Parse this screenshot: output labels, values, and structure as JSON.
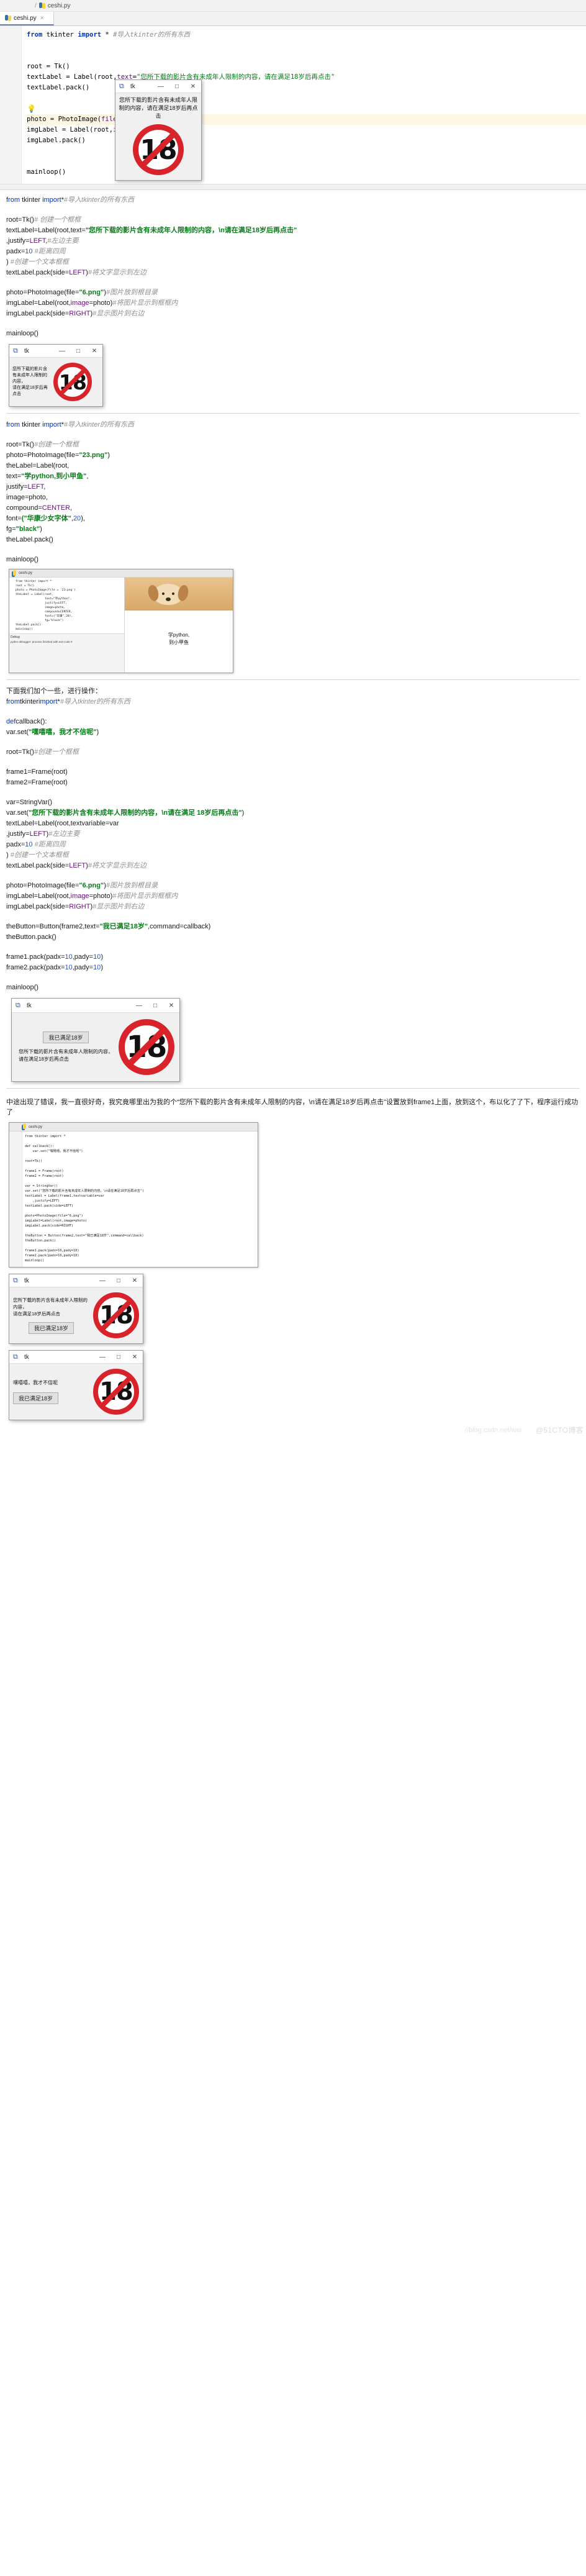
{
  "ide": {
    "breadcrumb": "ceshi.py",
    "tab_label": "ceshi.py",
    "close_glyph": "×",
    "python_icon": "python-file-icon"
  },
  "code_block_1": {
    "lines": [
      {
        "segs": [
          {
            "t": "from ",
            "c": "kw"
          },
          {
            "t": "tkinter ",
            "c": "t"
          },
          {
            "t": "import ",
            "c": "kw"
          },
          {
            "t": "* ",
            "c": "t"
          },
          {
            "t": "#导入tkinter的所有东西",
            "c": "c"
          }
        ]
      },
      {
        "segs": []
      },
      {
        "segs": []
      },
      {
        "segs": [
          {
            "t": "root = Tk()",
            "c": "t"
          }
        ]
      },
      {
        "segs": [
          {
            "t": "textLabel = Label(root,",
            "c": "t"
          },
          {
            "t": "text",
            "c": "p"
          },
          {
            "t": "=",
            "c": "t"
          },
          {
            "t": "\"您所下载的影片含有未成年人限制的内容，请在满足18岁后再点击\"",
            "c": "s"
          }
        ]
      },
      {
        "segs": [
          {
            "t": "textLabel.pack()",
            "c": "t"
          }
        ]
      },
      {
        "segs": []
      },
      {
        "segs": [
          {
            "t": "💡",
            "c": "t"
          }
        ],
        "bulb": true
      },
      {
        "segs": [
          {
            "t": "photo = PhotoImage(",
            "c": "t"
          },
          {
            "t": "file",
            "c": "p"
          },
          {
            "t": "=",
            "c": "t"
          },
          {
            "t": "\"6.png\"",
            "c": "s"
          },
          {
            "t": ")",
            "c": "t"
          }
        ],
        "hl": true
      },
      {
        "segs": [
          {
            "t": "imgLabel = Label(root,",
            "c": "t"
          },
          {
            "t": "image",
            "c": "p"
          },
          {
            "t": "=",
            "c": "t"
          },
          {
            "t": "photo)",
            "c": "t"
          }
        ]
      },
      {
        "segs": [
          {
            "t": "imgLabel.pack()",
            "c": "t"
          }
        ]
      },
      {
        "segs": []
      },
      {
        "segs": []
      },
      {
        "segs": [
          {
            "t": "mainloop()",
            "c": "t"
          }
        ]
      }
    ]
  },
  "tk_window_1": {
    "title": "tk",
    "message": "您所下载的影片含有未成年人限制的内容，请在满足18岁后再点击",
    "minimize": "—",
    "maximize": "□",
    "close": "✕",
    "sign_number": "18"
  },
  "text_block_1": {
    "lines": [
      [
        {
          "t": "from ",
          "c": "kwb"
        },
        {
          "t": "tkinter ",
          "c": ""
        },
        {
          "t": "import",
          "c": "kwb"
        },
        {
          "t": "*",
          "c": ""
        },
        {
          "t": "#导入tkinter的所有东西",
          "c": "cm"
        }
      ],
      [],
      [
        {
          "t": "root=Tk()",
          "c": ""
        },
        {
          "t": "# 创建一个框框",
          "c": "cm"
        }
      ],
      [
        {
          "t": "textLabel=Label(root,text=",
          "c": ""
        },
        {
          "t": "\"您所下载的影片含有未成年人限制的内容，\\n请在满足18岁后再点击\"",
          "c": "stb"
        }
      ],
      [
        {
          "t": ",justify=",
          "c": ""
        },
        {
          "t": "LEFT",
          "c": "pb"
        },
        {
          "t": ",",
          "c": ""
        },
        {
          "t": "#左边主要",
          "c": "cm"
        }
      ],
      [
        {
          "t": "padx=",
          "c": ""
        },
        {
          "t": "10",
          "c": "nb"
        },
        {
          "t": "    ",
          "c": ""
        },
        {
          "t": "#距离四周",
          "c": "cm"
        }
      ],
      [
        {
          "t": ")",
          "c": ""
        },
        {
          "t": "    #创建一个文本框框",
          "c": "cm"
        }
      ],
      [
        {
          "t": "textLabel.pack(side=",
          "c": ""
        },
        {
          "t": "LEFT",
          "c": "pb"
        },
        {
          "t": ")",
          "c": ""
        },
        {
          "t": "#将文字显示到左边",
          "c": "cm"
        }
      ],
      [],
      [
        {
          "t": "photo=PhotoImage(file=",
          "c": ""
        },
        {
          "t": "\"6.png\"",
          "c": "stb"
        },
        {
          "t": ")",
          "c": ""
        },
        {
          "t": "#图片放到根目录",
          "c": "cm"
        }
      ],
      [
        {
          "t": "imgLabel=Label(root,",
          "c": ""
        },
        {
          "t": "image",
          "c": "pb"
        },
        {
          "t": "=photo)",
          "c": ""
        },
        {
          "t": "#将图片显示到框框内",
          "c": "cm"
        }
      ],
      [
        {
          "t": "imgLabel.pack(side=",
          "c": ""
        },
        {
          "t": "RIGHT",
          "c": "pb"
        },
        {
          "t": ")",
          "c": ""
        },
        {
          "t": "#显示图片到右边",
          "c": "cm"
        }
      ],
      [],
      [
        {
          "t": "mainloop()",
          "c": ""
        }
      ]
    ]
  },
  "tk_window_2": {
    "title": "tk",
    "message": "您所下载的影片含有未成年人限制的内容，\n请在满足18岁后再点击",
    "minimize": "—",
    "maximize": "□",
    "close": "✕",
    "sign_number": "18"
  },
  "text_block_2": {
    "lines": [
      [
        {
          "t": "from ",
          "c": "kwb"
        },
        {
          "t": "tkinter ",
          "c": ""
        },
        {
          "t": "import",
          "c": "kwb"
        },
        {
          "t": "*",
          "c": ""
        },
        {
          "t": "#导入tkinter的所有东西",
          "c": "cm"
        }
      ],
      [],
      [
        {
          "t": "root=Tk()",
          "c": ""
        },
        {
          "t": "#创建一个框框",
          "c": "cm"
        }
      ],
      [
        {
          "t": "photo=PhotoImage(file=",
          "c": ""
        },
        {
          "t": "\"23.png\"",
          "c": "stb"
        },
        {
          "t": ")",
          "c": ""
        }
      ],
      [
        {
          "t": "theLabel=Label(root,",
          "c": ""
        }
      ],
      [
        {
          "t": "text=",
          "c": ""
        },
        {
          "t": "\"学python,到小甲鱼\"",
          "c": "stb"
        },
        {
          "t": ",",
          "c": ""
        }
      ],
      [
        {
          "t": "justify=",
          "c": ""
        },
        {
          "t": "LEFT",
          "c": "pb"
        },
        {
          "t": ",",
          "c": ""
        }
      ],
      [
        {
          "t": "image=photo,",
          "c": ""
        }
      ],
      [
        {
          "t": "compound=",
          "c": ""
        },
        {
          "t": "CENTER",
          "c": "pb"
        },
        {
          "t": ",",
          "c": ""
        }
      ],
      [
        {
          "t": "font=",
          "c": ""
        },
        {
          "t": "(\"华康少女字体\"",
          "c": "stb"
        },
        {
          "t": ",",
          "c": ""
        },
        {
          "t": "20",
          "c": "nb"
        },
        {
          "t": "),",
          "c": ""
        }
      ],
      [
        {
          "t": "fg=",
          "c": ""
        },
        {
          "t": "\"black\"",
          "c": "stb"
        },
        {
          "t": ")",
          "c": ""
        }
      ],
      [
        {
          "t": "theLabel.pack()",
          "c": ""
        }
      ],
      [],
      [
        {
          "t": "mainloop()",
          "c": ""
        }
      ]
    ]
  },
  "ide_shot_2": {
    "title_tabs": [
      "ceshi.py"
    ],
    "canvas_text_line1": "学python,",
    "canvas_text_line2": "到小甲鱼",
    "console_label": "Debug",
    "console_tabs": [
      "Debugger",
      "Console"
    ],
    "console_text": "pydev debugger: process  finished with exit code 0",
    "code_preview": [
      "from tkinter import *",
      "root = Tk()",
      "photo = PhotoImage(file = '23.png')",
      "theLabel = Label(root,",
      "                 text=\"学python\",",
      "                 justify=LEFT,",
      "                 image=photo,",
      "                 compound=CENTER,",
      "                 font=(\"华康\",20),",
      "                 fg=\"black\")",
      "theLabel.pack()",
      "mainloop()"
    ]
  },
  "text_block_3": {
    "intro": "下面我们加个一些，进行操作：",
    "lines": [
      [
        {
          "t": "from",
          "c": "kwb"
        },
        {
          "t": "tkinter",
          "c": ""
        },
        {
          "t": "import",
          "c": "kwb"
        },
        {
          "t": "*",
          "c": ""
        },
        {
          "t": "#导入tkinter的所有东西",
          "c": "cm"
        }
      ],
      [],
      [
        {
          "t": "def",
          "c": "kwb"
        },
        {
          "t": "callback():",
          "c": ""
        }
      ],
      [
        {
          "t": "var.set(",
          "c": ""
        },
        {
          "t": "\"嘿嘻嘻，我才不信呢\"",
          "c": "stb"
        },
        {
          "t": ")",
          "c": ""
        }
      ],
      [],
      [
        {
          "t": "root=Tk()",
          "c": ""
        },
        {
          "t": "#创建一个框框",
          "c": "cm"
        }
      ],
      [],
      [
        {
          "t": "frame1=Frame(root)",
          "c": ""
        }
      ],
      [
        {
          "t": "frame2=Frame(root)",
          "c": ""
        }
      ],
      [],
      [
        {
          "t": "var=StringVar()",
          "c": ""
        }
      ],
      [
        {
          "t": "var.set(",
          "c": ""
        },
        {
          "t": "\"您所下载的影片含有未成年人限制的内容，\\n请在满足 18岁后再点击\"",
          "c": "stb"
        },
        {
          "t": ")",
          "c": ""
        }
      ],
      [
        {
          "t": "textLabel=Label(root,textvariable=var",
          "c": ""
        }
      ],
      [
        {
          "t": ",justify=",
          "c": ""
        },
        {
          "t": "LEFT",
          "c": "pb"
        },
        {
          "t": ")",
          "c": ""
        },
        {
          "t": "#左边主要",
          "c": "cm"
        }
      ],
      [
        {
          "t": "padx=",
          "c": ""
        },
        {
          "t": "10",
          "c": "nb"
        },
        {
          "t": "  ",
          "c": ""
        },
        {
          "t": "#距离四周",
          "c": "cm"
        }
      ],
      [
        {
          "t": ")",
          "c": ""
        },
        {
          "t": "  #创建一个文本框框",
          "c": "cm"
        }
      ],
      [
        {
          "t": "textLabel.pack(side=",
          "c": ""
        },
        {
          "t": "LEFT",
          "c": "pb"
        },
        {
          "t": ")",
          "c": ""
        },
        {
          "t": "#将文字显示到左边",
          "c": "cm"
        }
      ],
      [],
      [
        {
          "t": "photo=PhotoImage(file=",
          "c": ""
        },
        {
          "t": "\"6.png\"",
          "c": "stb"
        },
        {
          "t": ")",
          "c": ""
        },
        {
          "t": "#图片放到根目录",
          "c": "cm"
        }
      ],
      [
        {
          "t": "imgLabel=Label(root,",
          "c": ""
        },
        {
          "t": "image",
          "c": "pb"
        },
        {
          "t": "=photo)",
          "c": ""
        },
        {
          "t": "#将图片显示到框框内",
          "c": "cm"
        }
      ],
      [
        {
          "t": "imgLabel.pack(side=",
          "c": ""
        },
        {
          "t": "RIGHT",
          "c": "pb"
        },
        {
          "t": ")",
          "c": ""
        },
        {
          "t": "#显示图片到右边",
          "c": "cm"
        }
      ],
      [],
      [
        {
          "t": "theButton=Button(frame2,text=",
          "c": ""
        },
        {
          "t": "\"我已满足18岁\"",
          "c": "stb"
        },
        {
          "t": ",command=callback)",
          "c": ""
        }
      ],
      [
        {
          "t": "theButton.pack()",
          "c": ""
        }
      ],
      [],
      [
        {
          "t": "frame1.pack(padx=",
          "c": ""
        },
        {
          "t": "10",
          "c": "nb"
        },
        {
          "t": ",pady=",
          "c": ""
        },
        {
          "t": "10",
          "c": "nb"
        },
        {
          "t": ")",
          "c": ""
        }
      ],
      [
        {
          "t": "frame2.pack(padx=",
          "c": ""
        },
        {
          "t": "10",
          "c": "nb"
        },
        {
          "t": ",pady=",
          "c": ""
        },
        {
          "t": "10",
          "c": "nb"
        },
        {
          "t": ")",
          "c": ""
        }
      ],
      [],
      [
        {
          "t": "mainloop()",
          "c": ""
        }
      ]
    ]
  },
  "tk_window_3": {
    "title": "tk",
    "message": "您所下载的影片含有未成年人限制的内容，\n请在满足18岁后再点击",
    "button": "我已满足18岁",
    "minimize": "—",
    "maximize": "□",
    "close": "✕",
    "sign_number": "18"
  },
  "paragraph_note": "中途出现了错误，我一直很好奇，我究竟哪里出为我的个“您所下载的影片含有未成年人限制的内容，\\n请在满足18岁后再点击\"设置放到frame1上面，放到这个，布以化了了下，程序运行成功了",
  "ide_shot_3": {
    "tab_label": "ceshi.py",
    "code_lines": [
      "from tkinter import *",
      "",
      "def callback():",
      "    var.set(\"嘿嘻嘻，我才不信呢\")",
      "",
      "root=Tk()",
      "",
      "frame1 = Frame(root)",
      "frame2 = Frame(root)",
      "",
      "var = StringVar()",
      "var.set(\"您所下载的影片含有未成年人限制的内容，\\n请在满足18岁后再点击\")",
      "textLabel = Label(frame1,textvariable=var",
      "    ,justify=LEFT)",
      "textLabel.pack(side=LEFT)",
      "",
      "photo=PhotoImage(file=\"6.png\")",
      "imgLabel=Label(root,image=photo)",
      "imgLabel.pack(side=RIGHT)",
      "",
      "theButton = Button(frame2,text=\"我已满足18岁\",command=callback)",
      "theButton.pack()",
      "",
      "frame1.pack(padx=10,pady=10)",
      "frame2.pack(padx=10,pady=10)",
      "mainloop()"
    ]
  },
  "tk_window_4": {
    "title": "tk",
    "message": "您所下载的影片含有未成年人限制的内容，\n请在满足18岁后再点击",
    "button": "我已满足18岁",
    "minimize": "—",
    "maximize": "□",
    "close": "✕",
    "sign_number": "18"
  },
  "tk_window_5": {
    "title": "tk",
    "message": "嘿嘻嘻，我才不信呢",
    "button": "我已满足18岁",
    "minimize": "—",
    "maximize": "□",
    "close": "✕",
    "sign_number": "18"
  },
  "watermark": {
    "url": "//blog.csdn.net/wei",
    "brand": "@51CTO博客"
  }
}
